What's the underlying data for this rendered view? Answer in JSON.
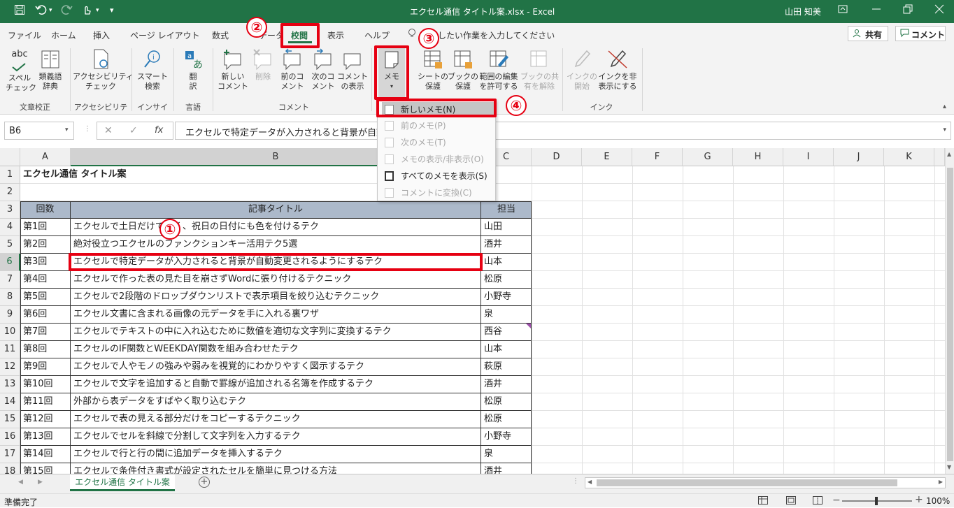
{
  "title_bar": {
    "file_title": "エクセル通信 タイトル案.xlsx  -  Excel",
    "user": "山田 知美",
    "qa_more": "▾"
  },
  "tabs": [
    "ファイル",
    "ホーム",
    "挿入",
    "ページ レイアウト",
    "数式",
    "データ",
    "校閲",
    "表示",
    "ヘルプ"
  ],
  "active_tab": "校閲",
  "tell_me": "実行したい作業を入力してください",
  "share_label": "共有",
  "comment_label": "コメント",
  "ribbon": {
    "spell": "スペル\nチェック",
    "thesaurus": "類義語\n辞典",
    "accessibility": "アクセシビリティ\nチェック",
    "smart_lookup": "スマート\n検索",
    "translate": "翻\n訳",
    "new_comment": "新しい\nコメント",
    "delete": "削除",
    "prev_comment": "前のコ\nメント",
    "next_comment": "次のコ\nメント",
    "show_comments": "コメント\nの表示",
    "memo": "メモ",
    "protect_sheet": "シートの\n保護",
    "protect_book": "ブックの\n保護",
    "allow_edit": "範囲の編集\nを許可する",
    "unshare": "ブックの共\n有を解除",
    "ink_start": "インクの\n開始",
    "hide_ink": "インクを非\n表示にする",
    "groups": {
      "proofing": "文章校正",
      "accessibility": "アクセシビリティ",
      "insights": "インサイト",
      "language": "言語",
      "comments": "コメント",
      "ink": "インク"
    }
  },
  "formula_bar": {
    "name_box": "B6",
    "fx": "fx",
    "formula": "エクセルで特定データが入力されると背景が自動変更されるようにするテク"
  },
  "memo_menu": {
    "items": [
      {
        "label": "新しいメモ(N)",
        "enabled": true
      },
      {
        "label": "前のメモ(P)",
        "enabled": false
      },
      {
        "label": "次のメモ(T)",
        "enabled": false
      },
      {
        "label": "メモの表示/非表示(O)",
        "enabled": false
      },
      {
        "label": "すべてのメモを表示(S)",
        "enabled": true
      },
      {
        "label": "コメントに変換(C)",
        "enabled": false
      }
    ]
  },
  "columns": [
    "A",
    "B",
    "C",
    "D",
    "E",
    "F",
    "G",
    "H",
    "I",
    "J",
    "K"
  ],
  "rows": [
    "1",
    "2",
    "3",
    "4",
    "5",
    "6",
    "7",
    "8",
    "9",
    "10",
    "11",
    "12",
    "13",
    "14",
    "15",
    "16",
    "17",
    "18"
  ],
  "sheet": {
    "title": "エクセル通信 タイトル案",
    "headers": {
      "a": "回数",
      "b": "記事タイトル",
      "c": "担当"
    },
    "data": [
      {
        "a": "第1回",
        "b": "エクセルで土日だけでなく、祝日の日付にも色を付けるテク",
        "c": "山田"
      },
      {
        "a": "第2回",
        "b": "絶対役立つエクセルのファンクションキー活用テク5選",
        "c": "酒井"
      },
      {
        "a": "第3回",
        "b": "エクセルで特定データが入力されると背景が自動変更されるようにするテク",
        "c": "山本"
      },
      {
        "a": "第4回",
        "b": "エクセルで作った表の見た目を崩さずWordに張り付けるテクニック",
        "c": "松原"
      },
      {
        "a": "第5回",
        "b": "エクセルで2段階のドロップダウンリストで表示項目を絞り込むテクニック",
        "c": "小野寺"
      },
      {
        "a": "第6回",
        "b": "エクセル文書に含まれる画像の元データを手に入れる裏ワザ",
        "c": "泉"
      },
      {
        "a": "第7回",
        "b": "エクセルでテキストの中に入れ込むために数値を適切な文字列に変換するテク",
        "c": "西谷"
      },
      {
        "a": "第8回",
        "b": "エクセルのIF関数とWEEKDAY関数を組み合わせたテク",
        "c": "山本"
      },
      {
        "a": "第9回",
        "b": "エクセルで人やモノの強みや弱みを視覚的にわかりやすく図示するテク",
        "c": "萩原"
      },
      {
        "a": "第10回",
        "b": "エクセルで文字を追加すると自動で罫線が追加される名簿を作成するテク",
        "c": "酒井"
      },
      {
        "a": "第11回",
        "b": "外部から表データをすばやく取り込むテク",
        "c": "松原"
      },
      {
        "a": "第12回",
        "b": "エクセルで表の見える部分だけをコピーするテクニック",
        "c": "松原"
      },
      {
        "a": "第13回",
        "b": "エクセルでセルを斜線で分割して文字列を入力するテク",
        "c": "小野寺"
      },
      {
        "a": "第14回",
        "b": "エクセルで行と行の間に追加データを挿入するテク",
        "c": "泉"
      },
      {
        "a": "第15回",
        "b": "エクセルで条件付き書式が設定されたセルを簡単に見つける方法",
        "c": "酒井"
      }
    ]
  },
  "sheet_tab": "エクセル通信 タイトル案",
  "status": "準備完了",
  "zoom": "100%",
  "annotations": [
    "①",
    "②",
    "③",
    "④"
  ],
  "colors": {
    "excel_green": "#217346",
    "annotation_red": "#e60012"
  }
}
